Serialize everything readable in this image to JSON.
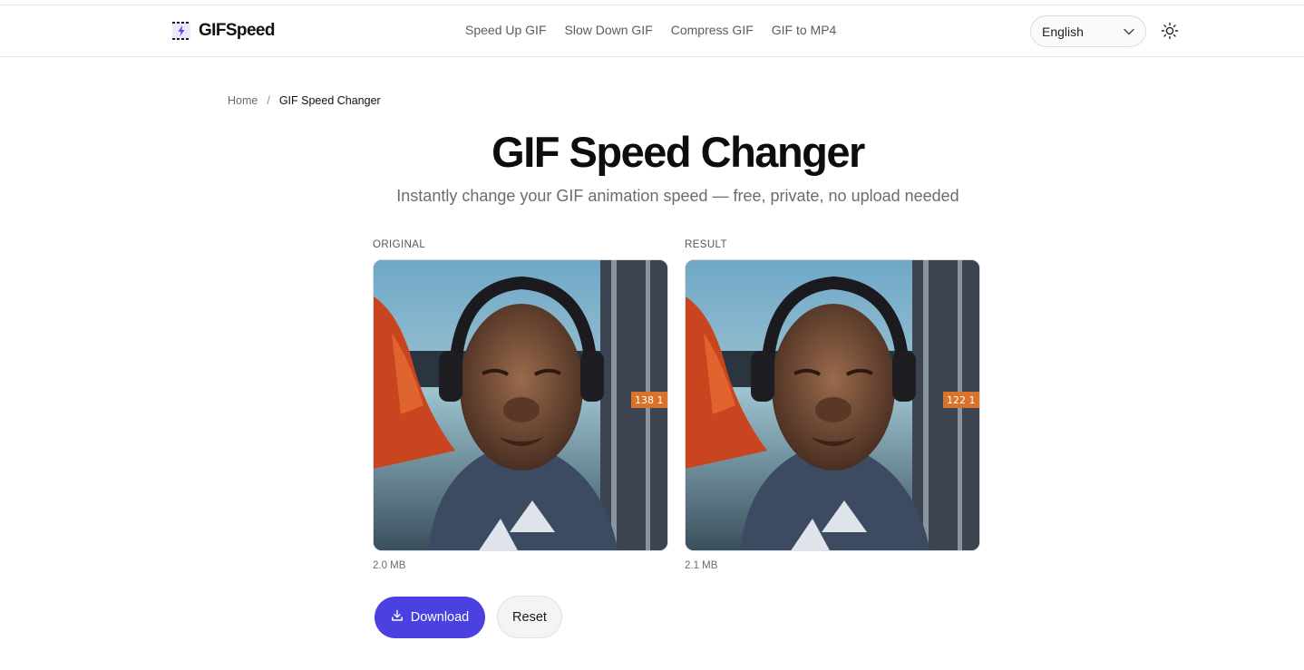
{
  "brand": {
    "name": "GIFSpeed",
    "logo_icon": "lightning-film-icon"
  },
  "nav": {
    "items": [
      {
        "label": "Speed Up GIF"
      },
      {
        "label": "Slow Down GIF"
      },
      {
        "label": "Compress GIF"
      },
      {
        "label": "GIF to MP4"
      }
    ]
  },
  "language": {
    "selected": "English",
    "icon": "chevron-down-icon"
  },
  "theme_toggle": {
    "icon": "sun-icon"
  },
  "breadcrumb": {
    "home": "Home",
    "separator": "/",
    "current": "GIF Speed Changer"
  },
  "page": {
    "title": "GIF Speed Changer",
    "subtitle": "Instantly change your GIF animation speed — free, private, no upload needed"
  },
  "original": {
    "label": "ORIGINAL",
    "size": "2.0 MB",
    "counter": "138 1"
  },
  "result": {
    "label": "RESULT",
    "size": "2.1 MB",
    "counter": "122 1"
  },
  "actions": {
    "download": "Download",
    "download_icon": "download-icon",
    "reset": "Reset"
  },
  "colors": {
    "accent": "#4b40e0"
  }
}
